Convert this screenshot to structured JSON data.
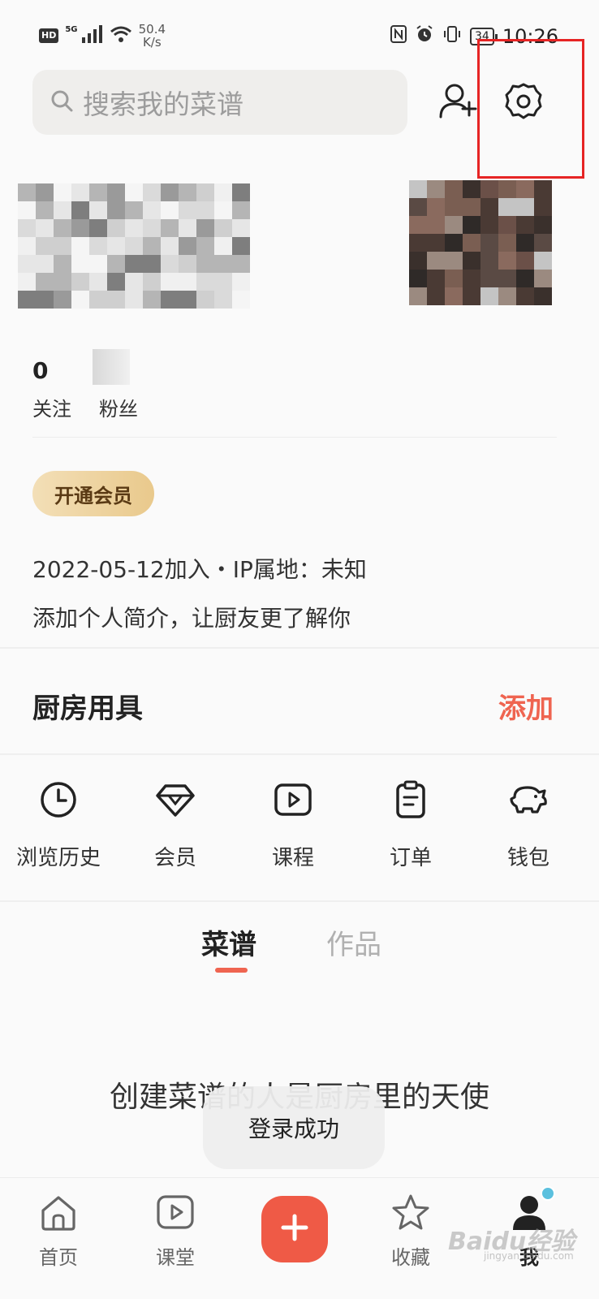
{
  "status_bar": {
    "hd": "HD",
    "signal": "5G",
    "speed_value": "50.4",
    "speed_unit": "K/s",
    "battery": "34",
    "time": "10:26"
  },
  "search": {
    "placeholder": "搜索我的菜谱"
  },
  "profile": {
    "stats": [
      {
        "value": "0",
        "label": "关注"
      },
      {
        "value": "",
        "label": "粉丝"
      }
    ],
    "vip_button": "开通会员",
    "join_info": "2022-05-12加入・IP属地：未知",
    "bio": "添加个人简介，让厨友更了解你"
  },
  "kitchen": {
    "title": "厨房用具",
    "add": "添加"
  },
  "quick_menu": [
    {
      "label": "浏览历史",
      "icon": "clock-icon"
    },
    {
      "label": "会员",
      "icon": "diamond-icon"
    },
    {
      "label": "课程",
      "icon": "play-icon"
    },
    {
      "label": "订单",
      "icon": "clipboard-icon"
    },
    {
      "label": "钱包",
      "icon": "piggy-bank-icon"
    }
  ],
  "tabs": [
    {
      "label": "菜谱"
    },
    {
      "label": "作品"
    }
  ],
  "empty_message": "创建菜谱的人是厨房里的天使",
  "toast": "登录成功",
  "bottom_nav": [
    {
      "label": "首页",
      "icon": "home-icon"
    },
    {
      "label": "课堂",
      "icon": "video-icon"
    },
    {
      "label": "",
      "icon": "plus-icon"
    },
    {
      "label": "收藏",
      "icon": "star-icon"
    },
    {
      "label": "我",
      "icon": "user-icon"
    }
  ],
  "watermark": {
    "text": "Baidu经验",
    "url": "jingyan.baidu.com"
  },
  "colors": {
    "accent": "#ef6450",
    "highlight": "#e62424",
    "vip_gold": "#e9c98c"
  }
}
